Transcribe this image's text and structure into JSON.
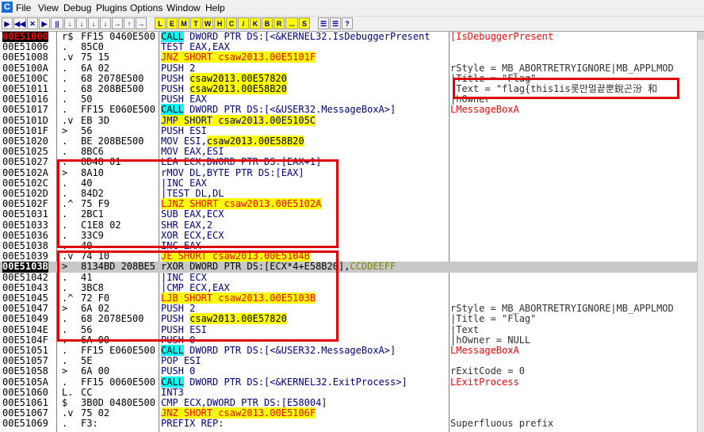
{
  "menu": [
    "File",
    "View",
    "Debug",
    "Plugins",
    "Options",
    "Window",
    "Help"
  ],
  "toolbar": [
    "▶",
    "◀◀",
    "✕",
    "▶",
    "||",
    "↓",
    "↓",
    "↓",
    "↓",
    "→",
    "↑",
    "→",
    "L",
    "E",
    "M",
    "T",
    "W",
    "H",
    "C",
    "/",
    "K",
    "B",
    "R",
    "...",
    "S",
    "☰",
    "☰",
    "?"
  ],
  "rows": [
    {
      "addr": "00E51000",
      "mk": "r$",
      "hex": "FF15 0460E500",
      "dis": "CALL DWORD PTR DS:[<&KERNEL32.IsDebuggerPresent",
      "cmt": "[IsDebuggerPresent",
      "type": "call",
      "selAddr": true
    },
    {
      "addr": "00E51006",
      "mk": ".",
      "hex": "85C0",
      "dis": "TEST EAX,EAX",
      "cmt": ""
    },
    {
      "addr": "00E51008",
      "mk": ".v",
      "hex": "75 15",
      "dis": "JNZ SHORT csaw2013.00E5101F",
      "cmt": "",
      "type": "jnz"
    },
    {
      "addr": "00E5100A",
      "mk": ".",
      "hex": "6A 02",
      "dis": "PUSH 2",
      "cmt": "rStyle = MB_ABORTRETRYIGNORE|MB_APPLMOD"
    },
    {
      "addr": "00E5100C",
      "mk": ".",
      "hex": "68 2078E500",
      "dis": "PUSH csaw2013.00E57820",
      "cmt": "|Title = \"Flag\"",
      "type": "pushy"
    },
    {
      "addr": "00E51011",
      "mk": ".",
      "hex": "68 208BE500",
      "dis": "PUSH csaw2013.00E58B20",
      "cmt": "|Text = \"flag{this1is롯만멀끝뿐銳곤汾 和",
      "type": "pushy"
    },
    {
      "addr": "00E51016",
      "mk": ".",
      "hex": "50",
      "dis": "PUSH EAX",
      "cmt": "|hOwner"
    },
    {
      "addr": "00E51017",
      "mk": ".",
      "hex": "FF15 E060E500",
      "dis": "CALL DWORD PTR DS:[<&USER32.MessageBoxA>]",
      "cmt": "LMessageBoxA",
      "type": "callc"
    },
    {
      "addr": "00E5101D",
      "mk": ".v",
      "hex": "EB 3D",
      "dis": "JMP SHORT csaw2013.00E5105C",
      "cmt": "",
      "type": "jmp"
    },
    {
      "addr": "00E5101F",
      "mk": ">",
      "hex": "56",
      "dis": "PUSH ESI",
      "cmt": ""
    },
    {
      "addr": "00E51020",
      "mk": ".",
      "hex": "BE 208BE500",
      "dis": "MOV ESI,csaw2013.00E58B20",
      "cmt": "",
      "type": "movy"
    },
    {
      "addr": "00E51025",
      "mk": ".",
      "hex": "8BC6",
      "dis": "MOV EAX,ESI",
      "cmt": ""
    },
    {
      "addr": "00E51027",
      "mk": ".",
      "hex": "8D48 01",
      "dis": "LEA ECX,DWORD PTR DS:[EAX+1]",
      "cmt": ""
    },
    {
      "addr": "00E5102A",
      "mk": ">",
      "hex": "8A10",
      "dis": "rMOV DL,BYTE PTR DS:[EAX]",
      "cmt": ""
    },
    {
      "addr": "00E5102C",
      "mk": ".",
      "hex": "40",
      "dis": "|INC EAX",
      "cmt": ""
    },
    {
      "addr": "00E5102D",
      "mk": ".",
      "hex": "84D2",
      "dis": "|TEST DL,DL",
      "cmt": ""
    },
    {
      "addr": "00E5102F",
      "mk": ".^",
      "hex": "75 F9",
      "dis": "LJNZ SHORT csaw2013.00E5102A",
      "cmt": "",
      "type": "jnzL"
    },
    {
      "addr": "00E51031",
      "mk": ".",
      "hex": "2BC1",
      "dis": "SUB EAX,ECX",
      "cmt": ""
    },
    {
      "addr": "00E51033",
      "mk": ".",
      "hex": "C1E8 02",
      "dis": "SHR EAX,2",
      "cmt": ""
    },
    {
      "addr": "00E51036",
      "mk": ".",
      "hex": "33C9",
      "dis": "XOR ECX,ECX",
      "cmt": ""
    },
    {
      "addr": "00E51038",
      "mk": ".",
      "hex": "40",
      "dis": "INC EAX",
      "cmt": ""
    },
    {
      "addr": "00E51039",
      "mk": ".v",
      "hex": "74 10",
      "dis": "JE SHORT csaw2013.00E5104B",
      "cmt": "",
      "type": "jnz"
    },
    {
      "addr": "00E5103B",
      "mk": ">",
      "hex": "8134BD 208BE5",
      "dis": "rXOR DWORD PTR DS:[ECX*4+E58B20],CCDDEEFF",
      "cmt": "",
      "type": "sel",
      "selAddr": true
    },
    {
      "addr": "00E51042",
      "mk": ".",
      "hex": "41",
      "dis": "|INC ECX",
      "cmt": ""
    },
    {
      "addr": "00E51043",
      "mk": ".",
      "hex": "3BC8",
      "dis": "|CMP ECX,EAX",
      "cmt": ""
    },
    {
      "addr": "00E51045",
      "mk": ".^",
      "hex": "72 F0",
      "dis": "LJB SHORT csaw2013.00E5103B",
      "cmt": "",
      "type": "jnzL"
    },
    {
      "addr": "00E51047",
      "mk": ">",
      "hex": "6A 02",
      "dis": "PUSH 2",
      "cmt": "rStyle = MB_ABORTRETRYIGNORE|MB_APPLMOD"
    },
    {
      "addr": "00E51049",
      "mk": ".",
      "hex": "68 2078E500",
      "dis": "PUSH csaw2013.00E57820",
      "cmt": "|Title = \"Flag\"",
      "type": "pushy"
    },
    {
      "addr": "00E5104E",
      "mk": ".",
      "hex": "56",
      "dis": "PUSH ESI",
      "cmt": "|Text"
    },
    {
      "addr": "00E5104F",
      "mk": ".",
      "hex": "6A 00",
      "dis": "PUSH 0",
      "cmt": "|hOwner = NULL"
    },
    {
      "addr": "00E51051",
      "mk": ".",
      "hex": "FF15 E060E500",
      "dis": "CALL DWORD PTR DS:[<&USER32.MessageBoxA>]",
      "cmt": "LMessageBoxA",
      "type": "callc"
    },
    {
      "addr": "00E51057",
      "mk": ".",
      "hex": "5E",
      "dis": "POP ESI",
      "cmt": ""
    },
    {
      "addr": "00E51058",
      "mk": ">",
      "hex": "6A 00",
      "dis": "PUSH 0",
      "cmt": "rExitCode = 0"
    },
    {
      "addr": "00E5105A",
      "mk": ".",
      "hex": "FF15 0060E500",
      "dis": "CALL DWORD PTR DS:[<&KERNEL32.ExitProcess>]",
      "cmt": "LExitProcess",
      "type": "callc"
    },
    {
      "addr": "00E51060",
      "mk": "L.",
      "hex": "CC",
      "dis": "INT3",
      "cmt": ""
    },
    {
      "addr": "00E51061",
      "mk": "$",
      "hex": "3B0D 0480E500",
      "dis": "CMP ECX,DWORD PTR DS:[E58004]",
      "cmt": ""
    },
    {
      "addr": "00E51067",
      "mk": ".v",
      "hex": "75 02",
      "dis": "JNZ SHORT csaw2013.00E5106F",
      "cmt": "",
      "type": "jnz"
    },
    {
      "addr": "00E51069",
      "mk": ".",
      "hex": "F3:",
      "dis": "PREFIX REP:",
      "cmt": "Superfluous prefix"
    }
  ]
}
